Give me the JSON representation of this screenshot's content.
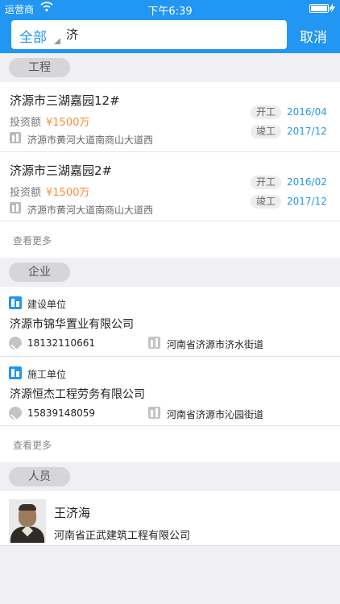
{
  "status_bar": {
    "carrier": "运营商",
    "time": "下午6:39",
    "battery_level": 1.0
  },
  "search": {
    "scope": "全部",
    "query": "济",
    "cancel_label": "取消"
  },
  "sections": {
    "projects": {
      "header": "工程",
      "items": [
        {
          "title": "济源市三湖嘉园12#",
          "invest_label": "投资额",
          "invest_value": "¥1500万",
          "address": "济源市黄河大道南商山大道西",
          "start_label": "开工",
          "start_date": "2016/04",
          "end_label": "竣工",
          "end_date": "2017/12"
        },
        {
          "title": "济源市三湖嘉园2#",
          "invest_label": "投资额",
          "invest_value": "¥1500万",
          "address": "济源市黄河大道南商山大道西",
          "start_label": "开工",
          "start_date": "2016/02",
          "end_label": "竣工",
          "end_date": "2017/12"
        }
      ],
      "more_label": "查看更多"
    },
    "companies": {
      "header": "企业",
      "items": [
        {
          "unit_type": "建设单位",
          "name": "济源市锦华置业有限公司",
          "phone": "18132110661",
          "address": "河南省济源市济水街道"
        },
        {
          "unit_type": "施工单位",
          "name": "济源恒杰工程劳务有限公司",
          "phone": "15839148059",
          "address": "河南省济源市沁园街道"
        }
      ],
      "more_label": "查看更多"
    },
    "people": {
      "header": "人员",
      "items": [
        {
          "name": "王济海",
          "company": "河南省正武建筑工程有限公司"
        }
      ]
    }
  },
  "colors": {
    "primary": "#2196f3",
    "invest_amount": "#ff8c3a",
    "background": "#efeff4"
  }
}
